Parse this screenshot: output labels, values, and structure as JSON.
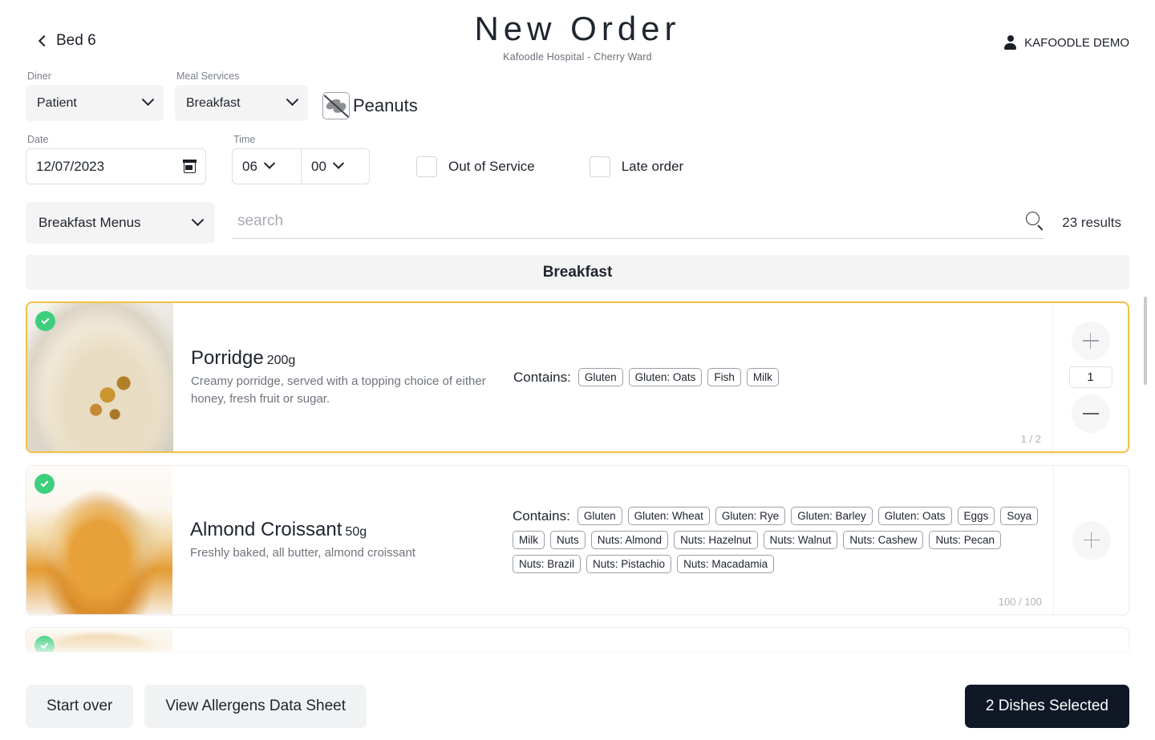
{
  "header": {
    "back_label": "Bed 6",
    "title": "New Order",
    "subtitle": "Kafoodle Hospital - Cherry Ward",
    "user_label": "KAFOODLE DEMO"
  },
  "form": {
    "diner": {
      "label": "Diner",
      "value": "Patient"
    },
    "meal_services": {
      "label": "Meal Services",
      "value": "Breakfast"
    },
    "allergen_flag": "Peanuts",
    "date": {
      "label": "Date",
      "value": "12/07/2023"
    },
    "time": {
      "label": "Time",
      "hour": "06",
      "minute": "00"
    },
    "out_of_service": {
      "label": "Out of Service",
      "checked": false
    },
    "late_order": {
      "label": "Late order",
      "checked": false
    }
  },
  "search": {
    "menu_filter": "Breakfast Menus",
    "placeholder": "search",
    "value": "",
    "results": "23 results"
  },
  "section": {
    "band_label": "Breakfast"
  },
  "dishes": [
    {
      "name": "Porridge",
      "weight": "200g",
      "description": "Creamy porridge, served with a topping choice of either honey, fresh fruit or sugar.",
      "contains_label": "Contains:",
      "allergens": [
        "Gluten",
        "Gluten: Oats",
        "Fish",
        "Milk"
      ],
      "quantity": "1",
      "portion_note": "1 / 2",
      "selected": true
    },
    {
      "name": "Almond Croissant",
      "weight": "50g",
      "description": "Freshly baked, all butter, almond croissant",
      "contains_label": "Contains:",
      "allergens": [
        "Gluten",
        "Gluten: Wheat",
        "Gluten: Rye",
        "Gluten: Barley",
        "Gluten: Oats",
        "Eggs",
        "Soya",
        "Milk",
        "Nuts",
        "Nuts: Almond",
        "Nuts: Hazelnut",
        "Nuts: Walnut",
        "Nuts: Cashew",
        "Nuts: Pecan",
        "Nuts: Brazil",
        "Nuts: Pistachio",
        "Nuts: Macadamia"
      ],
      "quantity": "",
      "portion_note": "100 / 100",
      "selected": true
    }
  ],
  "footer": {
    "start_over": "Start over",
    "allergens_sheet": "View Allergens Data Sheet",
    "selected_summary": "2 Dishes Selected"
  },
  "colors": {
    "selected_border": "#f3c244",
    "check_badge": "#3ecf7e",
    "primary_button": "#101826"
  }
}
